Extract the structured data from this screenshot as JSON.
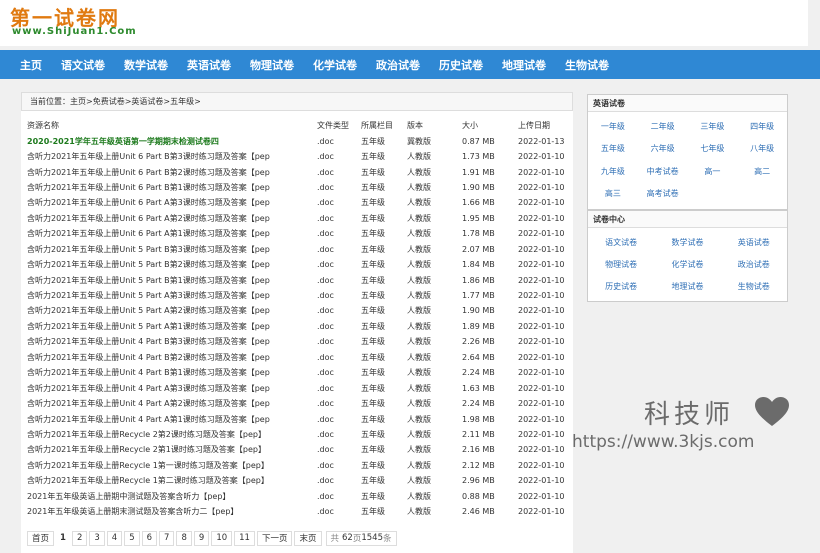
{
  "logo": {
    "cn": "第一试卷网",
    "url": "www.ShiJuan1.Com"
  },
  "nav": [
    "主页",
    "语文试卷",
    "数学试卷",
    "英语试卷",
    "物理试卷",
    "化学试卷",
    "政治试卷",
    "历史试卷",
    "地理试卷",
    "生物试卷"
  ],
  "breadcrumb": {
    "label": "当前位置：",
    "items": [
      "主页",
      "免费试卷",
      "英语试卷",
      "五年级"
    ],
    "sep": ">"
  },
  "table": {
    "headers": [
      "资源名称",
      "文件类型",
      "所属栏目",
      "版本",
      "大小",
      "上传日期"
    ],
    "rows": [
      [
        "2020-2021学年五年级英语第一学期期末检测试卷四",
        ".doc",
        "五年级",
        "冀教版",
        "0.87 MB",
        "2022-01-13"
      ],
      [
        "含听力2021年五年级上册Unit 6 Part B第3课时练习题及答案【pep",
        ".doc",
        "五年级",
        "人教版",
        "1.73 MB",
        "2022-01-10"
      ],
      [
        "含听力2021年五年级上册Unit 6 Part B第2课时练习题及答案【pep",
        ".doc",
        "五年级",
        "人教版",
        "1.91 MB",
        "2022-01-10"
      ],
      [
        "含听力2021年五年级上册Unit 6 Part B第1课时练习题及答案【pep",
        ".doc",
        "五年级",
        "人教版",
        "1.90 MB",
        "2022-01-10"
      ],
      [
        "含听力2021年五年级上册Unit 6 Part A第3课时练习题及答案【pep",
        ".doc",
        "五年级",
        "人教版",
        "1.66 MB",
        "2022-01-10"
      ],
      [
        "含听力2021年五年级上册Unit 6 Part A第2课时练习题及答案【pep",
        ".doc",
        "五年级",
        "人教版",
        "1.95 MB",
        "2022-01-10"
      ],
      [
        "含听力2021年五年级上册Unit 6 Part A第1课时练习题及答案【pep",
        ".doc",
        "五年级",
        "人教版",
        "1.78 MB",
        "2022-01-10"
      ],
      [
        "含听力2021年五年级上册Unit 5 Part B第3课时练习题及答案【pep",
        ".doc",
        "五年级",
        "人教版",
        "2.07 MB",
        "2022-01-10"
      ],
      [
        "含听力2021年五年级上册Unit 5 Part B第2课时练习题及答案【pep",
        ".doc",
        "五年级",
        "人教版",
        "1.84 MB",
        "2022-01-10"
      ],
      [
        "含听力2021年五年级上册Unit 5 Part B第1课时练习题及答案【pep",
        ".doc",
        "五年级",
        "人教版",
        "1.86 MB",
        "2022-01-10"
      ],
      [
        "含听力2021年五年级上册Unit 5 Part A第3课时练习题及答案【pep",
        ".doc",
        "五年级",
        "人教版",
        "1.77 MB",
        "2022-01-10"
      ],
      [
        "含听力2021年五年级上册Unit 5 Part A第2课时练习题及答案【pep",
        ".doc",
        "五年级",
        "人教版",
        "1.90 MB",
        "2022-01-10"
      ],
      [
        "含听力2021年五年级上册Unit 5 Part A第1课时练习题及答案【pep",
        ".doc",
        "五年级",
        "人教版",
        "1.89 MB",
        "2022-01-10"
      ],
      [
        "含听力2021年五年级上册Unit 4 Part B第3课时练习题及答案【pep",
        ".doc",
        "五年级",
        "人教版",
        "2.26 MB",
        "2022-01-10"
      ],
      [
        "含听力2021年五年级上册Unit 4 Part B第2课时练习题及答案【pep",
        ".doc",
        "五年级",
        "人教版",
        "2.64 MB",
        "2022-01-10"
      ],
      [
        "含听力2021年五年级上册Unit 4 Part B第1课时练习题及答案【pep",
        ".doc",
        "五年级",
        "人教版",
        "2.24 MB",
        "2022-01-10"
      ],
      [
        "含听力2021年五年级上册Unit 4 Part A第3课时练习题及答案【pep",
        ".doc",
        "五年级",
        "人教版",
        "1.63 MB",
        "2022-01-10"
      ],
      [
        "含听力2021年五年级上册Unit 4 Part A第2课时练习题及答案【pep",
        ".doc",
        "五年级",
        "人教版",
        "2.24 MB",
        "2022-01-10"
      ],
      [
        "含听力2021年五年级上册Unit 4 Part A第1课时练习题及答案【pep",
        ".doc",
        "五年级",
        "人教版",
        "1.98 MB",
        "2022-01-10"
      ],
      [
        "含听力2021年五年级上册Recycle 2第2课时练习题及答案【pep】",
        ".doc",
        "五年级",
        "人教版",
        "2.11 MB",
        "2022-01-10"
      ],
      [
        "含听力2021年五年级上册Recycle 2第1课时练习题及答案【pep】",
        ".doc",
        "五年级",
        "人教版",
        "2.16 MB",
        "2022-01-10"
      ],
      [
        "含听力2021年五年级上册Recycle 1第一课时练习题及答案【pep】",
        ".doc",
        "五年级",
        "人教版",
        "2.12 MB",
        "2022-01-10"
      ],
      [
        "含听力2021年五年级上册Recycle 1第二课时练习题及答案【pep】",
        ".doc",
        "五年级",
        "人教版",
        "2.96 MB",
        "2022-01-10"
      ],
      [
        "2021年五年级英语上册期中测试题及答案含听力【pep】",
        ".doc",
        "五年级",
        "人教版",
        "0.88 MB",
        "2022-01-10"
      ],
      [
        "2021年五年级英语上册期末测试题及答案含听力二【pep】",
        ".doc",
        "五年级",
        "人教版",
        "2.46 MB",
        "2022-01-10"
      ]
    ]
  },
  "pager": {
    "first": "首页",
    "pages": [
      "1",
      "2",
      "3",
      "4",
      "5",
      "6",
      "7",
      "8",
      "9",
      "10",
      "11"
    ],
    "current": "1",
    "next": "下一页",
    "last": "末页",
    "info_prefix": "共",
    "total_pages": "62",
    "info_mid": "页",
    "total_items": "1545",
    "info_suffix": "条"
  },
  "sidebar": {
    "english": {
      "title": "英语试卷",
      "items": [
        "一年级",
        "二年级",
        "三年级",
        "四年级",
        "五年级",
        "六年级",
        "七年级",
        "八年级",
        "九年级",
        "中考试卷",
        "高一",
        "高二",
        "高三",
        "高考试卷"
      ]
    },
    "center": {
      "title": "试卷中心",
      "items": [
        "语文试卷",
        "数学试卷",
        "英语试卷",
        "物理试卷",
        "化学试卷",
        "政治试卷",
        "历史试卷",
        "地理试卷",
        "生物试卷"
      ]
    }
  },
  "watermark": {
    "title": "科技师",
    "url": "https://www.3kjs.com"
  },
  "colors": {
    "nav": "#2f88d4",
    "link": "#2f6fb5",
    "highlight": "#1d7a1d",
    "logo": "#e07a10"
  }
}
